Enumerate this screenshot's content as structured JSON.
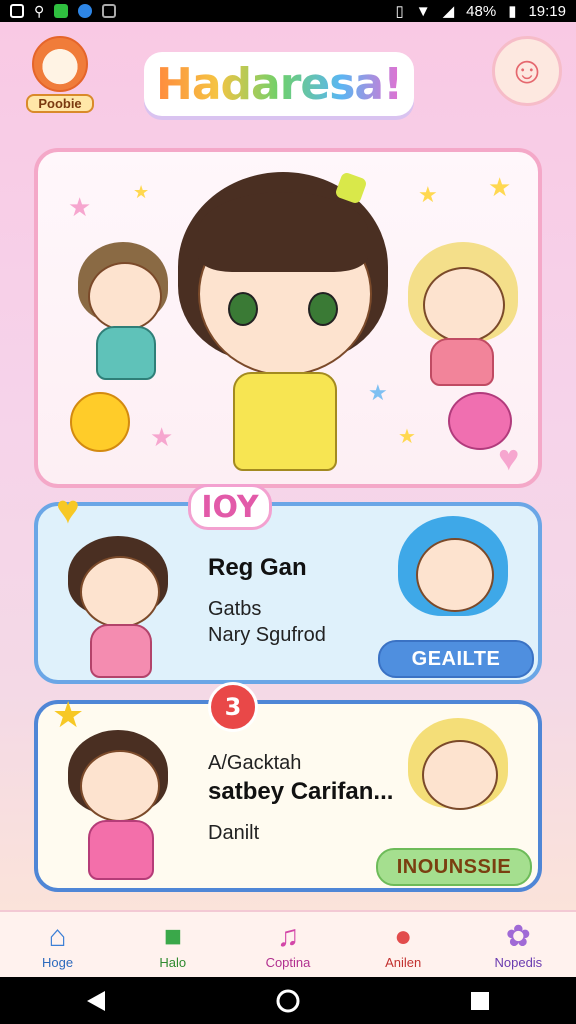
{
  "status_bar": {
    "battery": "48%",
    "time": "19:19",
    "icons": [
      "gallery-icon",
      "signal-icon",
      "shield-icon",
      "chrome-icon",
      "image-icon",
      "vibrate-icon",
      "wifi-icon",
      "cell-icon",
      "battery-icon"
    ]
  },
  "header": {
    "logo_text": "Poobie",
    "app_title": "Hadaresa!",
    "profile_icon": "smiley-face-icon"
  },
  "hero": {
    "characters": [
      "girl-brown-pigtails",
      "girl-teal-dress",
      "girl-blonde-pink",
      "sun-creature",
      "pink-blob"
    ]
  },
  "cards": [
    {
      "badge": "IOY",
      "title": "Reg Gan",
      "line1": "Gatbs",
      "line2": "Nary Sgufrod",
      "button": "GEAILTE"
    },
    {
      "badge": "3",
      "line1": "A/Gacktah",
      "title": "satbey Carifan...",
      "line3": "Danilt",
      "button": "INOUNSSIE"
    }
  ],
  "bottom_nav": [
    {
      "label": "Hoge",
      "icon": "home-icon",
      "color": "#3c7fd6"
    },
    {
      "label": "Halo",
      "icon": "note-icon",
      "color": "#3aa84a"
    },
    {
      "label": "Coptina",
      "icon": "music-note-icon",
      "color": "#d347a8"
    },
    {
      "label": "Anilen",
      "icon": "chat-bubble-icon",
      "color": "#e24c4c"
    },
    {
      "label": "Nopedis",
      "icon": "flower-icon",
      "color": "#a06ad6"
    }
  ]
}
